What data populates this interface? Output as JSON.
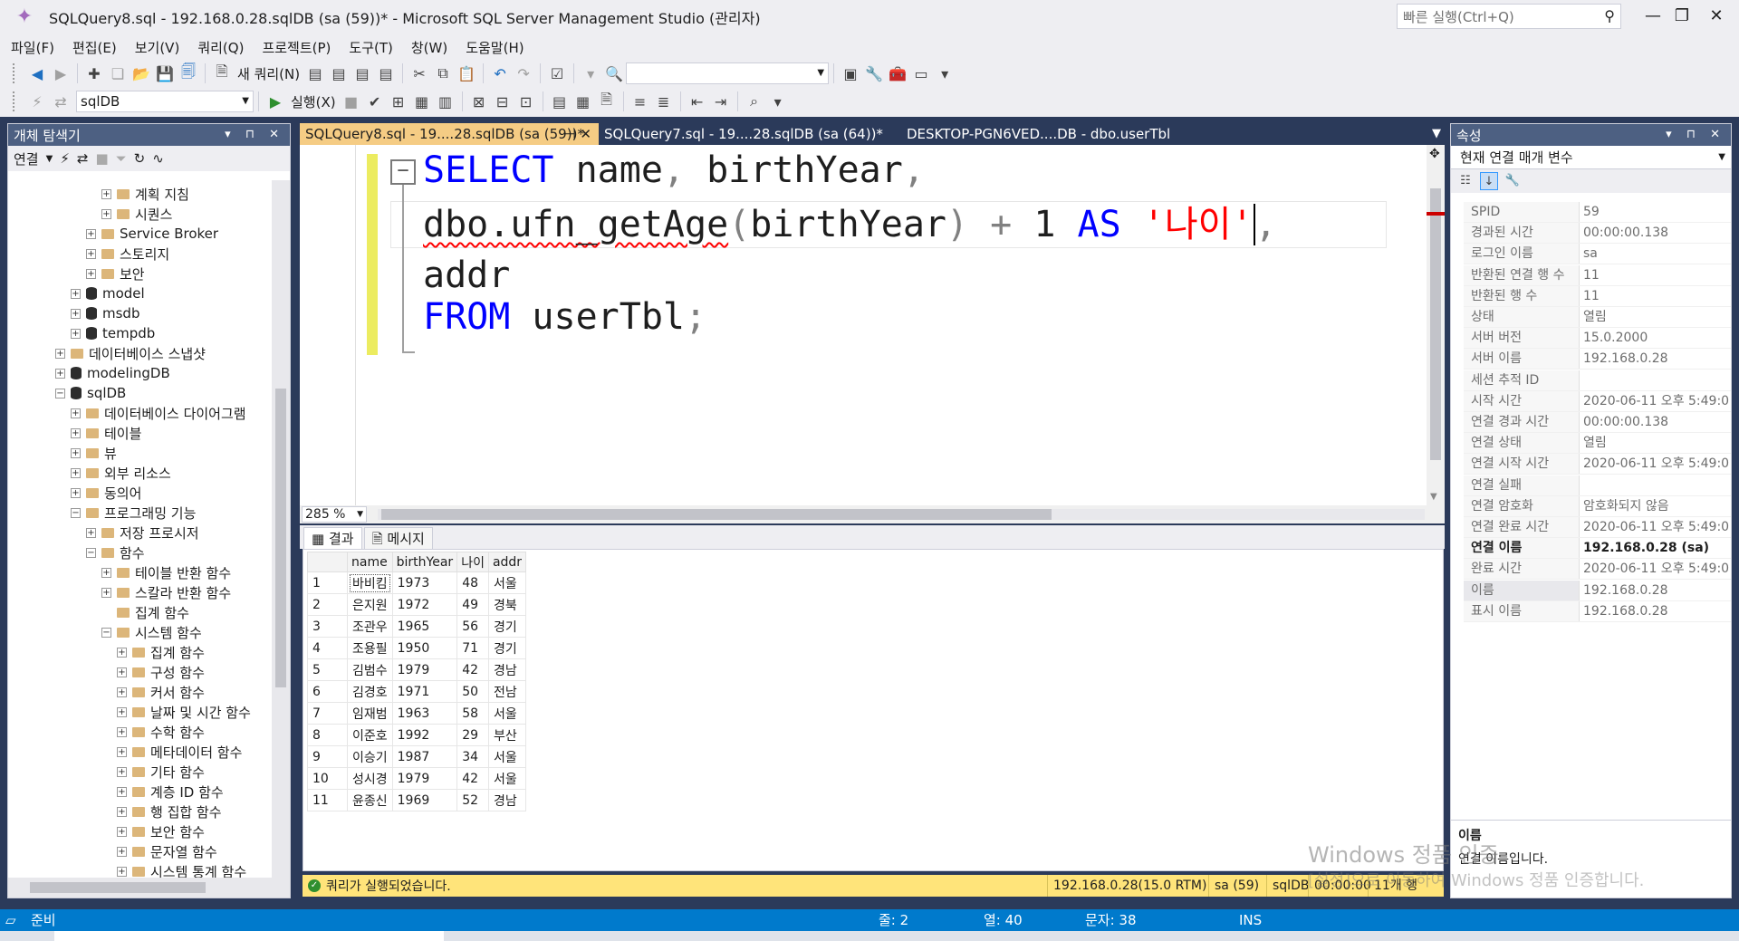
{
  "window": {
    "title": "SQLQuery8.sql - 192.168.0.28.sqlDB (sa (59))* - Microsoft SQL Server Management Studio (관리자)",
    "quick_launch_placeholder": "빠른 실행(Ctrl+Q)",
    "minimize": "—",
    "restore": "❐",
    "close": "✕"
  },
  "menu": [
    "파일(F)",
    "편집(E)",
    "보기(V)",
    "쿼리(Q)",
    "프로젝트(P)",
    "도구(T)",
    "창(W)",
    "도움말(H)"
  ],
  "toolbar1": {
    "new_query_label": "새 쿼리(N)"
  },
  "toolbar2": {
    "database": "sqlDB",
    "execute_label": "실행(X)"
  },
  "object_explorer": {
    "title": "개체 탐색기",
    "connect_label": "연결",
    "header_buttons": "▾ ⊓ ✕",
    "tree": [
      {
        "label": "계획 지침",
        "indent": 5,
        "icon": "folder",
        "exp": "+"
      },
      {
        "label": "시퀀스",
        "indent": 5,
        "icon": "folder",
        "exp": "+"
      },
      {
        "label": "Service Broker",
        "indent": 4,
        "icon": "folder",
        "exp": "+"
      },
      {
        "label": "스토리지",
        "indent": 4,
        "icon": "folder",
        "exp": "+"
      },
      {
        "label": "보안",
        "indent": 4,
        "icon": "folder",
        "exp": "+"
      },
      {
        "label": "model",
        "indent": 3,
        "icon": "db",
        "exp": "+"
      },
      {
        "label": "msdb",
        "indent": 3,
        "icon": "db",
        "exp": "+"
      },
      {
        "label": "tempdb",
        "indent": 3,
        "icon": "db",
        "exp": "+"
      },
      {
        "label": "데이터베이스 스냅샷",
        "indent": 2,
        "icon": "folder",
        "exp": "+"
      },
      {
        "label": "modelingDB",
        "indent": 2,
        "icon": "db",
        "exp": "+"
      },
      {
        "label": "sqlDB",
        "indent": 2,
        "icon": "db",
        "exp": "−"
      },
      {
        "label": "데이터베이스 다이어그램",
        "indent": 3,
        "icon": "folder",
        "exp": "+"
      },
      {
        "label": "테이블",
        "indent": 3,
        "icon": "folder",
        "exp": "+"
      },
      {
        "label": "뷰",
        "indent": 3,
        "icon": "folder",
        "exp": "+"
      },
      {
        "label": "외부 리소스",
        "indent": 3,
        "icon": "folder",
        "exp": "+"
      },
      {
        "label": "동의어",
        "indent": 3,
        "icon": "folder",
        "exp": "+"
      },
      {
        "label": "프로그래밍 기능",
        "indent": 3,
        "icon": "folder",
        "exp": "−"
      },
      {
        "label": "저장 프로시저",
        "indent": 4,
        "icon": "folder",
        "exp": "+"
      },
      {
        "label": "함수",
        "indent": 4,
        "icon": "folder",
        "exp": "−"
      },
      {
        "label": "테이블 반환 함수",
        "indent": 5,
        "icon": "folder",
        "exp": "+"
      },
      {
        "label": "스칼라 반환 함수",
        "indent": 5,
        "icon": "folder",
        "exp": "+"
      },
      {
        "label": "집계 함수",
        "indent": 5,
        "icon": "folder",
        "exp": ""
      },
      {
        "label": "시스템 함수",
        "indent": 5,
        "icon": "folder",
        "exp": "−"
      },
      {
        "label": "집계 함수",
        "indent": 6,
        "icon": "folder",
        "exp": "+"
      },
      {
        "label": "구성 함수",
        "indent": 6,
        "icon": "folder",
        "exp": "+"
      },
      {
        "label": "커서 함수",
        "indent": 6,
        "icon": "folder",
        "exp": "+"
      },
      {
        "label": "날짜 및 시간 함수",
        "indent": 6,
        "icon": "folder",
        "exp": "+"
      },
      {
        "label": "수학 함수",
        "indent": 6,
        "icon": "folder",
        "exp": "+"
      },
      {
        "label": "메타데이터 함수",
        "indent": 6,
        "icon": "folder",
        "exp": "+"
      },
      {
        "label": "기타 함수",
        "indent": 6,
        "icon": "folder",
        "exp": "+"
      },
      {
        "label": "계층 ID 함수",
        "indent": 6,
        "icon": "folder",
        "exp": "+"
      },
      {
        "label": "행 집합 함수",
        "indent": 6,
        "icon": "folder",
        "exp": "+"
      },
      {
        "label": "보안 함수",
        "indent": 6,
        "icon": "folder",
        "exp": "+"
      },
      {
        "label": "문자열 함수",
        "indent": 6,
        "icon": "folder",
        "exp": "+"
      },
      {
        "label": "시스템 통계 함수",
        "indent": 6,
        "icon": "folder",
        "exp": "+"
      }
    ]
  },
  "tabs": [
    {
      "label": "SQLQuery8.sql - 19....28.sqlDB (sa (59))*",
      "pin": "⊣ ✕",
      "active": true
    },
    {
      "label": "SQLQuery7.sql - 19....28.sqlDB (sa (64))*",
      "active": false
    },
    {
      "label": "DESKTOP-PGN6VED....DB - dbo.userTbl",
      "active": false
    }
  ],
  "editor": {
    "collapse_glyph": "−",
    "lines": {
      "l1_select": "SELECT",
      "l1_name": " name",
      "l1_comma": ",",
      "l1_by": " birthYear",
      "l1_comma2": ",",
      "l2_fn": "dbo.ufn_getAge",
      "l2_open": "(",
      "l2_by": "birthYear",
      "l2_close": ")",
      "l2_plus": " + ",
      "l2_one": "1",
      "l2_as": " AS ",
      "l2_str": "'나이'",
      "l2_comma": ",",
      "l3": "addr",
      "l4_from": "FROM",
      "l4_tbl": " userTbl",
      "l4_semi": ";"
    },
    "zoom": "285 %"
  },
  "results": {
    "tab_results": "결과",
    "tab_messages": "메시지",
    "columns": [
      "",
      "name",
      "birthYear",
      "나이",
      "addr"
    ],
    "rows": [
      [
        "1",
        "바비킴",
        "1973",
        "48",
        "서울"
      ],
      [
        "2",
        "은지원",
        "1972",
        "49",
        "경북"
      ],
      [
        "3",
        "조관우",
        "1965",
        "56",
        "경기"
      ],
      [
        "4",
        "조용필",
        "1950",
        "71",
        "경기"
      ],
      [
        "5",
        "김범수",
        "1979",
        "42",
        "경남"
      ],
      [
        "6",
        "김경호",
        "1971",
        "50",
        "전남"
      ],
      [
        "7",
        "임재범",
        "1963",
        "58",
        "서울"
      ],
      [
        "8",
        "이준호",
        "1992",
        "29",
        "부산"
      ],
      [
        "9",
        "이승기",
        "1987",
        "34",
        "서울"
      ],
      [
        "10",
        "성시경",
        "1979",
        "42",
        "서울"
      ],
      [
        "11",
        "윤종신",
        "1969",
        "52",
        "경남"
      ]
    ]
  },
  "query_status": {
    "message": "쿼리가 실행되었습니다.",
    "server": "192.168.0.28(15.0 RTM)",
    "user": "sa (59)",
    "db": "sqlDB",
    "time": "00:00:00",
    "rows": "11개 행"
  },
  "properties": {
    "title": "속성",
    "combo": "현재 연결 매개 변수",
    "rows": [
      {
        "k": "SPID",
        "v": "59"
      },
      {
        "k": "경과된 시간",
        "v": "00:00:00.138"
      },
      {
        "k": "로그인 이름",
        "v": "sa"
      },
      {
        "k": "반환된 연결 행 수",
        "v": "11"
      },
      {
        "k": "반환된 행 수",
        "v": "11"
      },
      {
        "k": "상태",
        "v": "열림"
      },
      {
        "k": "서버 버전",
        "v": "15.0.2000"
      },
      {
        "k": "서버 이름",
        "v": "192.168.0.28"
      },
      {
        "k": "세션 추적 ID",
        "v": ""
      },
      {
        "k": "시작 시간",
        "v": "2020-06-11 오후 5:49:0"
      },
      {
        "k": "연결 경과 시간",
        "v": "00:00:00.138"
      },
      {
        "k": "연결 상태",
        "v": "열림"
      },
      {
        "k": "연결 시작 시간",
        "v": "2020-06-11 오후 5:49:0"
      },
      {
        "k": "연결 실패",
        "v": ""
      },
      {
        "k": "연결 암호화",
        "v": "암호화되지 않음"
      },
      {
        "k": "연결 완료 시간",
        "v": "2020-06-11 오후 5:49:0"
      },
      {
        "k": "연결 이름",
        "v": "192.168.0.28 (sa)"
      },
      {
        "k": "완료 시간",
        "v": "2020-06-11 오후 5:49:0"
      },
      {
        "k": "이름",
        "v": "192.168.0.28"
      },
      {
        "k": "표시 이름",
        "v": "192.168.0.28"
      }
    ],
    "desc_title": "이름",
    "desc_text": "연결 이름입니다."
  },
  "watermark": {
    "line1": "Windows 정품 인증",
    "line2": "[설정]으로 이동하여 Windows 정품 인증합니다."
  },
  "statusbar": {
    "ready": "준비",
    "line": "줄: 2",
    "col": "열: 40",
    "ch": "문자: 38",
    "ins": "INS"
  }
}
